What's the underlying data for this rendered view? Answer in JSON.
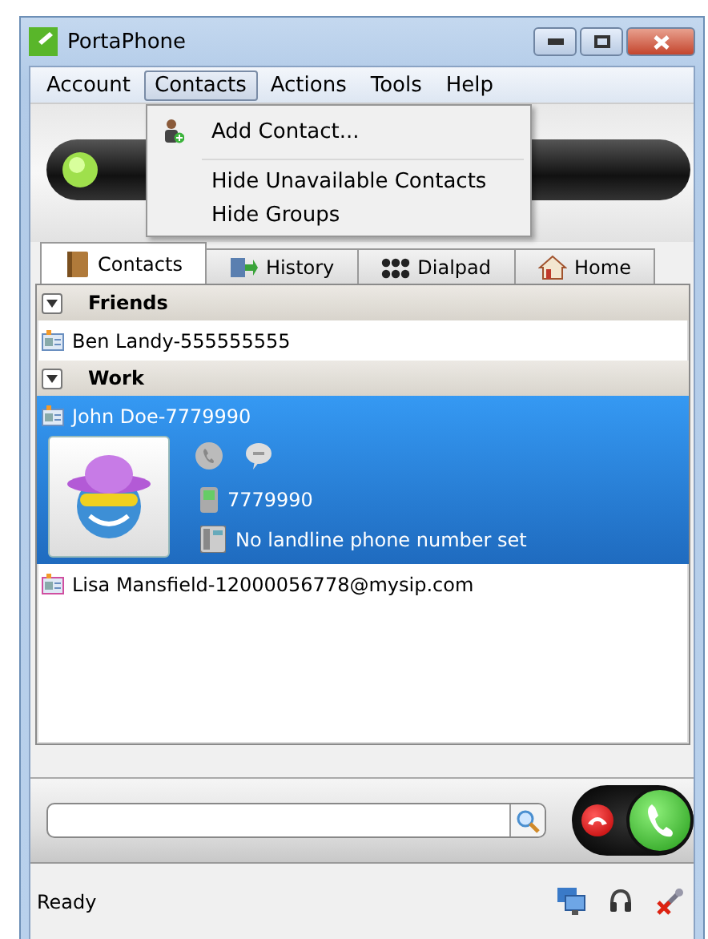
{
  "window": {
    "title": "PortaPhone"
  },
  "menu": [
    {
      "label": "Account",
      "selected": false
    },
    {
      "label": "Contacts",
      "selected": true
    },
    {
      "label": "Actions",
      "selected": false
    },
    {
      "label": "Tools",
      "selected": false
    },
    {
      "label": "Help",
      "selected": false
    }
  ],
  "dropdown": {
    "items": [
      {
        "kind": "action",
        "label": "Add Contact..."
      },
      {
        "kind": "separator"
      },
      {
        "kind": "plain",
        "label": "Hide Unavailable Contacts"
      },
      {
        "kind": "plain",
        "label": "Hide Groups"
      }
    ]
  },
  "tabs": [
    {
      "label": "Contacts",
      "kind": "contacts",
      "selected": true
    },
    {
      "label": "History",
      "kind": "history",
      "selected": false
    },
    {
      "label": "Dialpad",
      "kind": "dialpad",
      "selected": false
    },
    {
      "label": "Home",
      "kind": "home",
      "selected": false
    }
  ],
  "groups": [
    {
      "name": "Friends",
      "expanded": true,
      "contacts": [
        {
          "name": "Ben Landy-555555555",
          "selected": false
        }
      ]
    },
    {
      "name": "Work",
      "expanded": true,
      "contacts": [
        {
          "name": "John Doe-7779990",
          "selected": true,
          "mobile": "7779990",
          "landline": "No landline phone number set"
        },
        {
          "name": "Lisa Mansfield-12000056778@mysip.com",
          "selected": false
        }
      ]
    }
  ],
  "status_bar": {
    "text": "Ready"
  }
}
